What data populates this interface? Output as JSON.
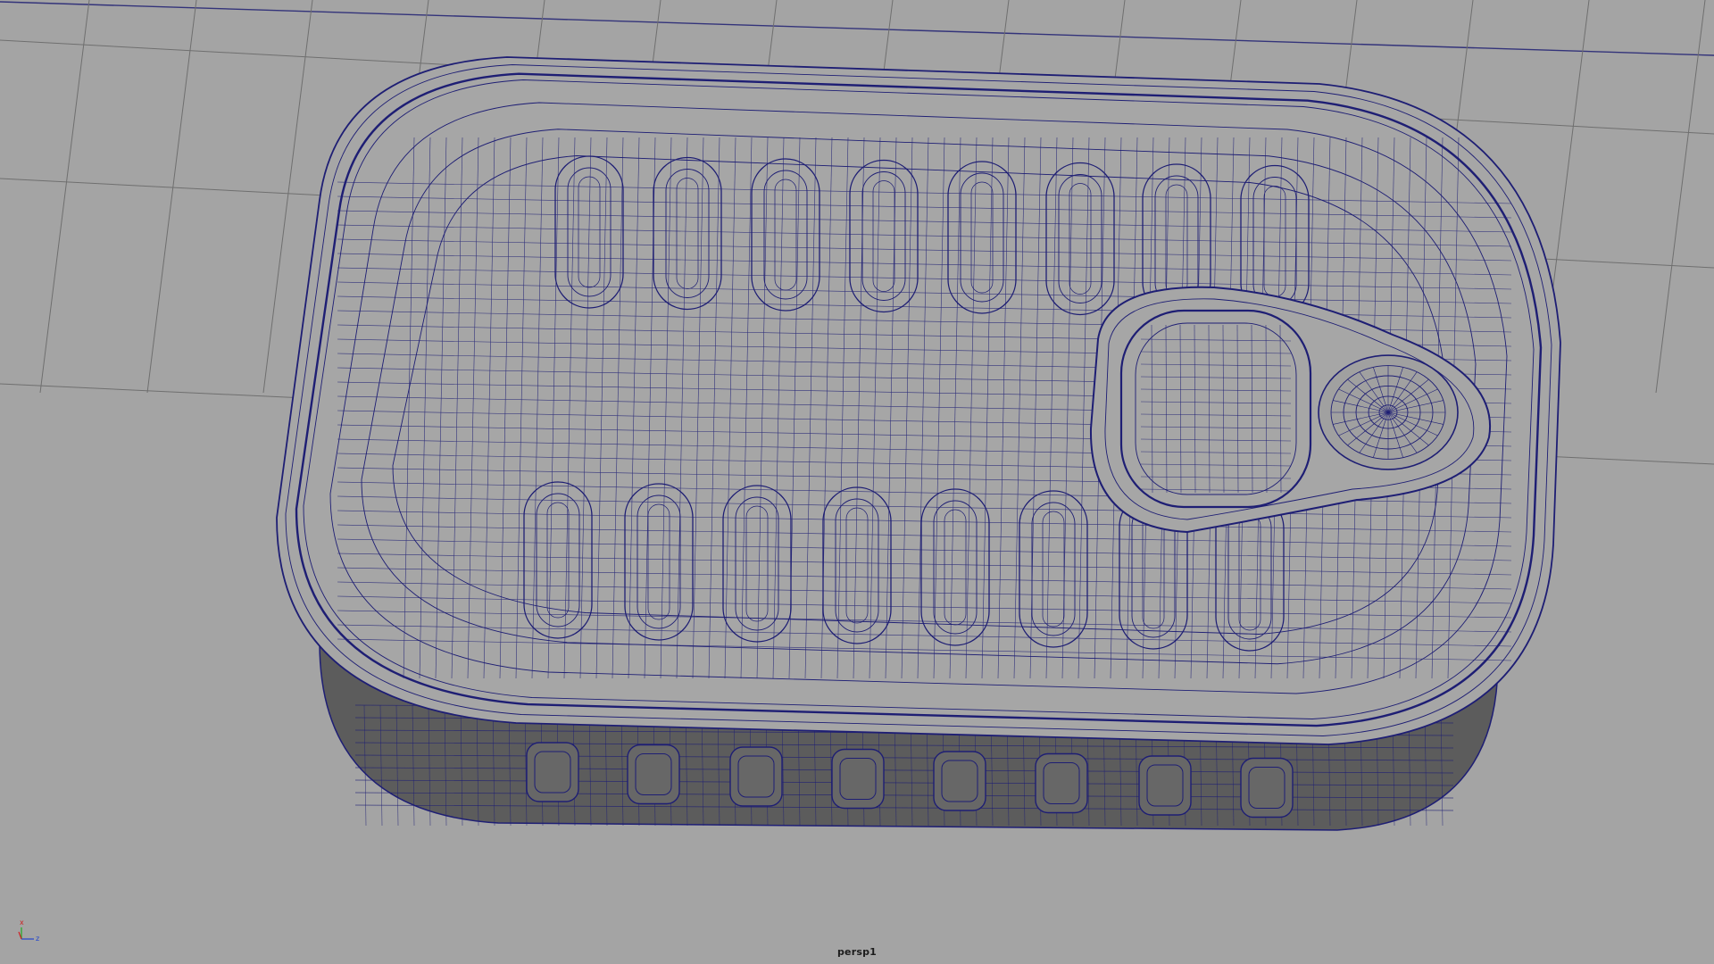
{
  "viewport": {
    "camera_name": "persp1",
    "background_color": "#a4a4a4",
    "grid_color": "#6f6f6f",
    "wireframe_color": "#1e1e74",
    "shading_colors": {
      "top": "#a6a6a6",
      "wall": "#5c5c5c"
    }
  },
  "axis_gizmo": {
    "x_label": "x",
    "y_label": "y",
    "z_label": "z",
    "x_color": "#cc2222",
    "y_color": "#22aa22",
    "z_color": "#2244cc"
  }
}
